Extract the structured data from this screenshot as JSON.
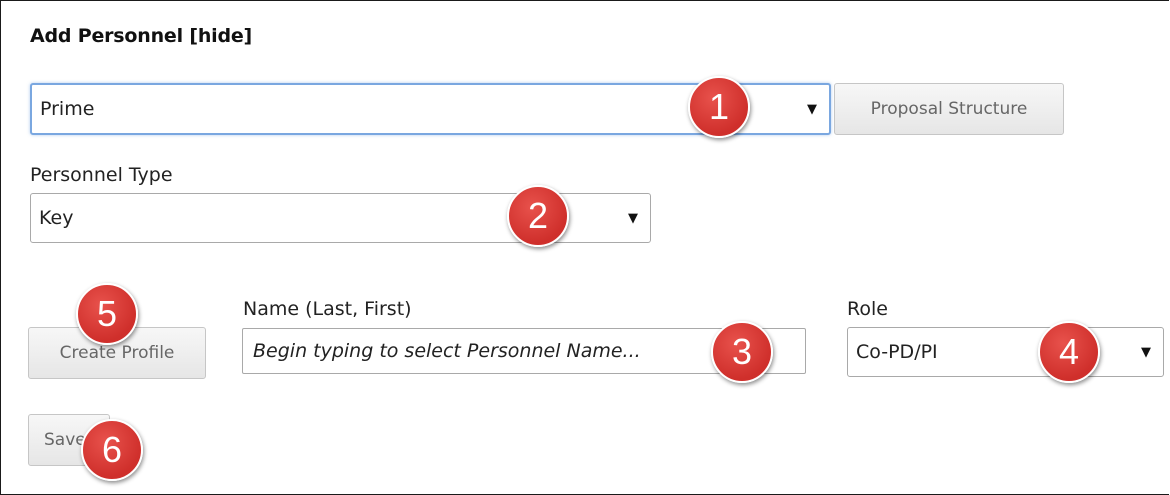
{
  "panel": {
    "title": "Add Personnel [hide]"
  },
  "structure_select": {
    "value": "Prime",
    "arrow": "▼"
  },
  "proposal_structure_button": {
    "label": "Proposal Structure"
  },
  "personnel_type": {
    "label": "Personnel Type",
    "value": "Key",
    "arrow": "▼"
  },
  "create_profile_button": {
    "label": "Create Profile"
  },
  "name_field": {
    "label": "Name (Last, First)",
    "placeholder": "Begin typing to select Personnel Name..."
  },
  "role": {
    "label": "Role",
    "value": "Co-PD/PI",
    "arrow": "▼"
  },
  "save_button": {
    "label": "Save"
  },
  "callouts": [
    "1",
    "2",
    "3",
    "4",
    "5",
    "6"
  ],
  "colors": {
    "callout": "#d9383a",
    "focus_border": "#7aa7e0",
    "button_text": "#666666"
  }
}
